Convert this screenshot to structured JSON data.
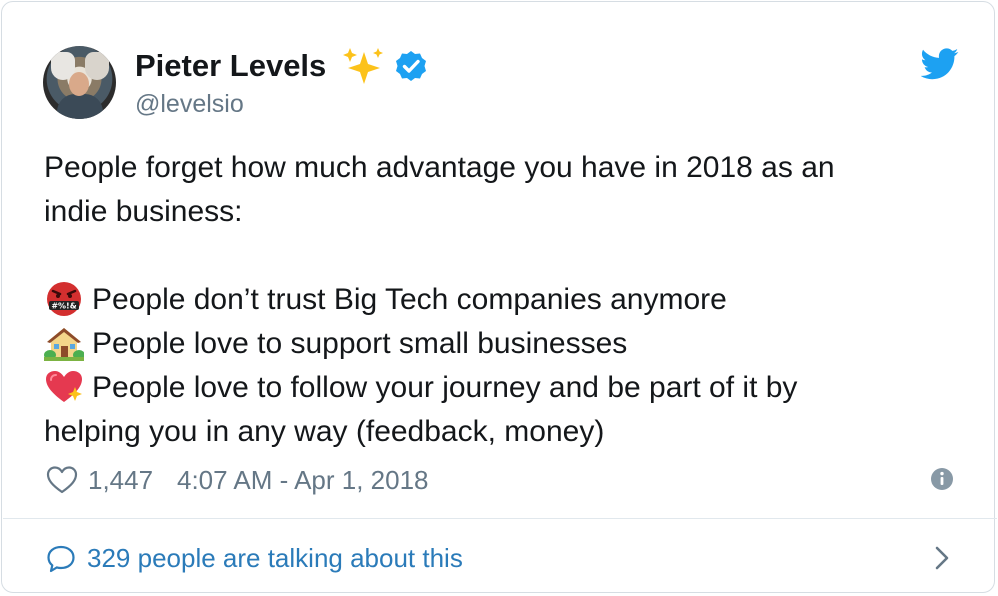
{
  "author": {
    "name": "Pieter Levels",
    "handle": "@levelsio",
    "name_emoji": "sparkles-icon",
    "verified": true
  },
  "tweet": {
    "lines": [
      "People forget how much advantage you have in 2018 as an",
      "indie business:",
      "",
      "People don’t trust Big Tech companies anymore",
      "People love to support small businesses",
      "People love to follow your journey and be part of it by",
      "helping you in any way (feedback, money)"
    ],
    "bullet_icons": [
      "swearing-face-icon",
      "house-with-garden-icon",
      "sparkling-heart-icon"
    ]
  },
  "meta": {
    "likes": "1,447",
    "timestamp": "4:07 AM - Apr 1, 2018"
  },
  "footer": {
    "talking_label": "329 people are talking about this"
  },
  "colors": {
    "text": "#14171a",
    "muted": "#657786",
    "link": "#2b7bb9",
    "twitter_blue": "#1da1f2",
    "border": "#d6dde3"
  }
}
